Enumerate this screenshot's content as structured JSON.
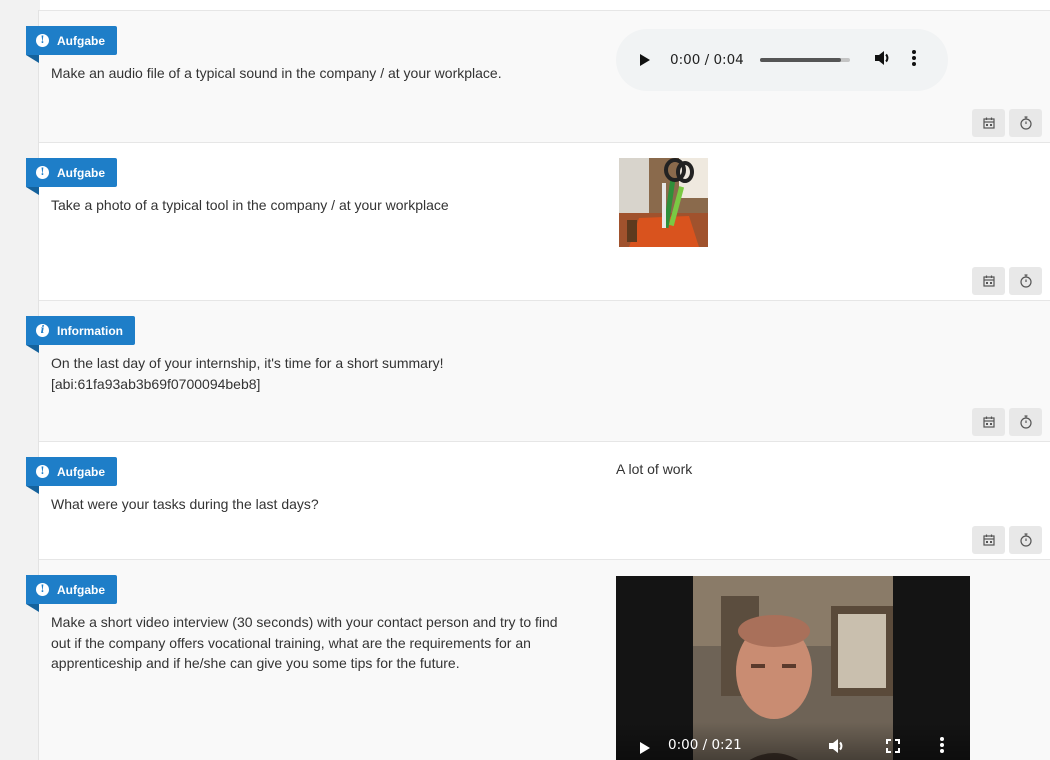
{
  "entries": [
    {
      "badge": {
        "label": "Aufgabe",
        "icon": "exclamation-circle-icon",
        "symbol": "!"
      },
      "text": "Make an audio file of a typical sound in the company / at your workplace.",
      "media": {
        "type": "audio",
        "time": "0:00 / 0:04",
        "progress": 0.9
      }
    },
    {
      "badge": {
        "label": "Aufgabe",
        "icon": "exclamation-circle-icon",
        "symbol": "!"
      },
      "text": "Take a photo of a typical tool in the company / at your workplace",
      "media": {
        "type": "image"
      }
    },
    {
      "badge": {
        "label": "Information",
        "icon": "info-circle-icon",
        "symbol": "i"
      },
      "text_lines": [
        "On the last day of your internship, it's time for a short summary!",
        "[abi:61fa93ab3b69f0700094beb8]"
      ]
    },
    {
      "badge": {
        "label": "Aufgabe",
        "icon": "exclamation-circle-icon",
        "symbol": "!"
      },
      "text": "What were your tasks during the last days?",
      "answer": "A lot of work"
    },
    {
      "badge": {
        "label": "Aufgabe",
        "icon": "exclamation-circle-icon",
        "symbol": "!"
      },
      "text_lines": [
        "Make a short video interview (30 seconds) with your contact person and try to find",
        "out if the company offers vocational training, what are the requirements for an",
        "apprenticeship and if he/she can give you some tips for the future."
      ],
      "media": {
        "type": "video",
        "time": "0:00 / 0:21",
        "progress": 0.06
      }
    }
  ],
  "actions": {
    "calendar_icon": "calendar-icon",
    "timer_icon": "stopwatch-icon"
  },
  "colors": {
    "badge": "#1e7ec8",
    "badge_fold": "#15629c",
    "row_alt": "#f9f9f9",
    "button": "#e8e8e8"
  }
}
